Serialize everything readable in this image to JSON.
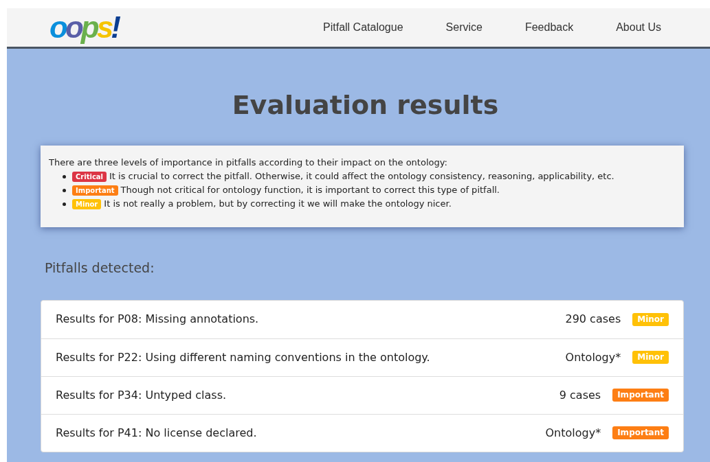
{
  "header": {
    "logo": "oops!",
    "nav": [
      {
        "label": "Pitfall Catalogue"
      },
      {
        "label": "Service"
      },
      {
        "label": "Feedback"
      },
      {
        "label": "About Us"
      }
    ]
  },
  "title": "Evaluation results",
  "legend": {
    "intro": "There are three levels of importance in pitfalls according to their impact on the ontology:",
    "items": [
      {
        "badge": "Critical",
        "kind": "critical",
        "text": "It is crucial to correct the pitfall. Otherwise, it could affect the ontology consistency, reasoning, applicability, etc."
      },
      {
        "badge": "Important",
        "kind": "important",
        "text": "Though not critical for ontology function, it is important to correct this type of pitfall."
      },
      {
        "badge": "Minor",
        "kind": "minor",
        "text": "It is not really a problem, but by correcting it we will make the ontology nicer."
      }
    ]
  },
  "pitfalls": {
    "heading": "Pitfalls detected:",
    "rows": [
      {
        "label": "Results for P08: Missing annotations.",
        "count": "290 cases",
        "badge": "Minor",
        "kind": "minor"
      },
      {
        "label": "Results for P22: Using different naming conventions in the ontology.",
        "count": "Ontology*",
        "badge": "Minor",
        "kind": "minor"
      },
      {
        "label": "Results for P34: Untyped class.",
        "count": "9 cases",
        "badge": "Important",
        "kind": "important"
      },
      {
        "label": "Results for P41: No license declared.",
        "count": "Ontology*",
        "badge": "Important",
        "kind": "important"
      }
    ]
  }
}
